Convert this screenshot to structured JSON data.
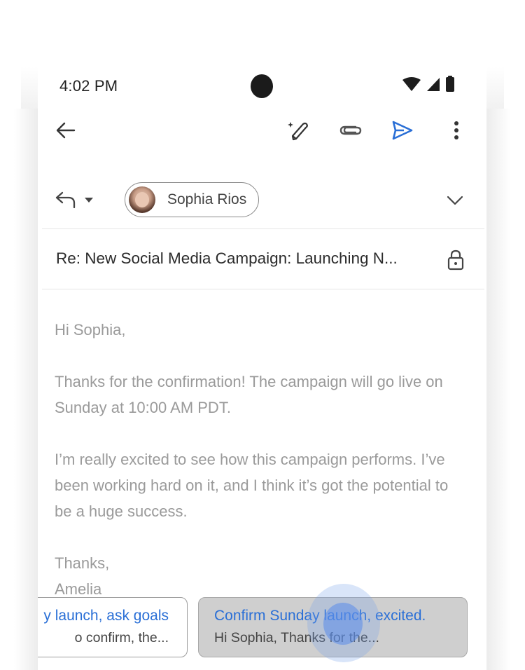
{
  "status_bar": {
    "time": "4:02 PM",
    "icons": [
      "wifi-icon",
      "cellular-signal-icon",
      "battery-icon"
    ]
  },
  "toolbar": {
    "back_icon": "arrow-left-icon",
    "actions": [
      {
        "name": "help-me-write-button",
        "icon": "magic-pen-icon"
      },
      {
        "name": "attach-button",
        "icon": "paperclip-icon"
      },
      {
        "name": "send-button",
        "icon": "send-icon"
      },
      {
        "name": "more-options-button",
        "icon": "more-vert-icon"
      }
    ]
  },
  "compose": {
    "reply_mode_icon": "reply-icon",
    "recipient": {
      "name": "Sophia Rios"
    },
    "subject": "Re: New Social Media Campaign: Launching N...",
    "body": {
      "greeting": "Hi Sophia,",
      "paragraph_1": "Thanks for the confirmation! The campaign will go live on Sunday at 10:00 AM PDT.",
      "paragraph_2": "I’m really excited to see how this campaign performs. I’ve been working hard on it, and I think it’s got the potential to be a huge success.",
      "closing": "Thanks,",
      "signature": "Amelia"
    }
  },
  "suggestions": [
    {
      "title": "y launch, ask goals",
      "preview": "o confirm, the..."
    },
    {
      "title": "Confirm Sunday launch, excited.",
      "preview": "Hi Sophia, Thanks for the..."
    }
  ],
  "colors": {
    "accent": "#2a6fd6",
    "send": "#2a6fd6",
    "selected_suggestion_bg": "#cfcfcf"
  }
}
